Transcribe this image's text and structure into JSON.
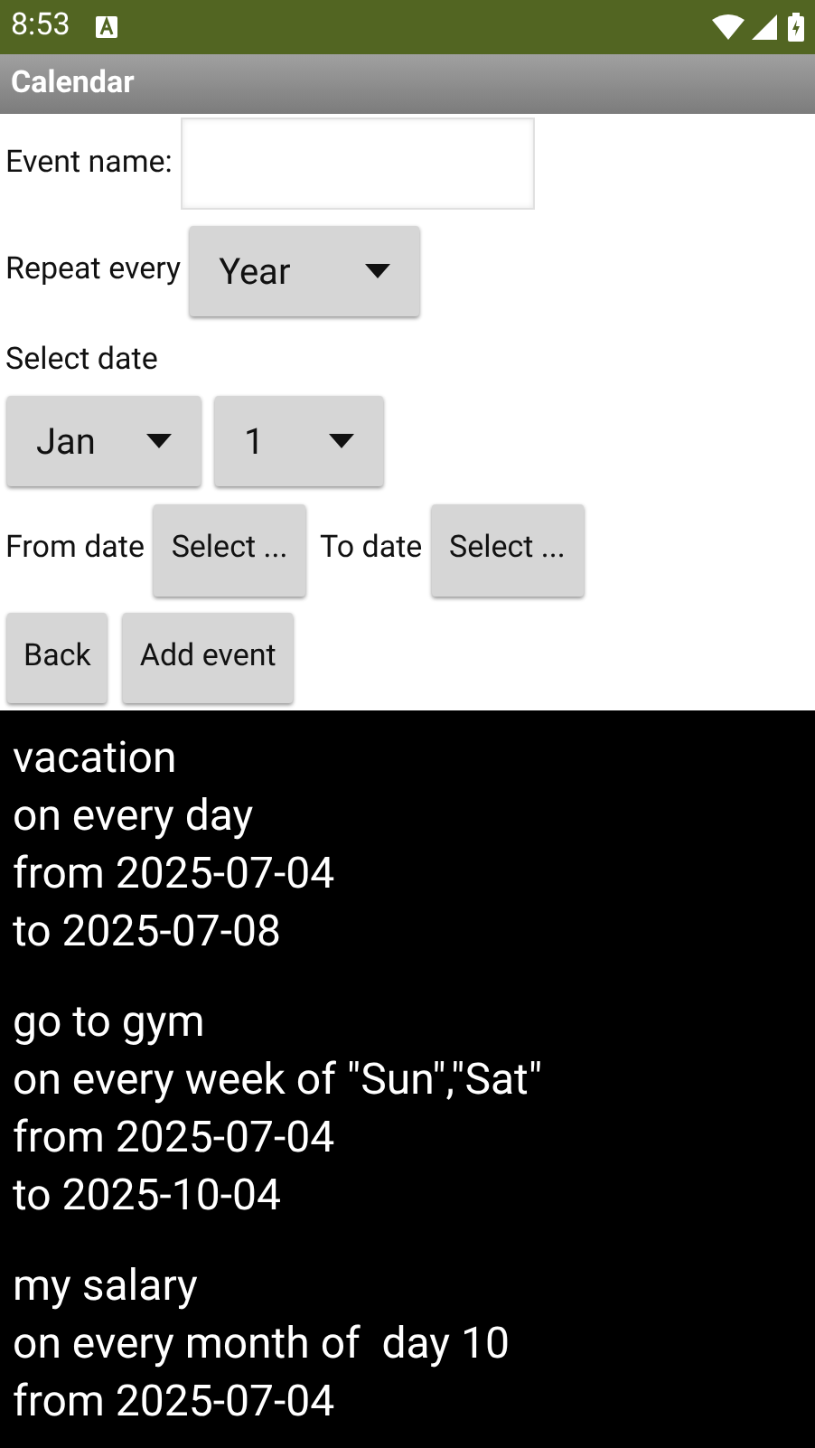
{
  "status_bar": {
    "time": "8:53"
  },
  "app_bar": {
    "title": "Calendar"
  },
  "form": {
    "event_name": {
      "label": "Event name:"
    },
    "repeat": {
      "label": "Repeat every",
      "value": "Year"
    },
    "select_date": {
      "label": "Select date",
      "month": "Jan",
      "day": "1"
    },
    "from_date": {
      "label": "From date",
      "button": "Select ..."
    },
    "to_date": {
      "label": "To date",
      "button": "Select ..."
    },
    "buttons": [
      "Back",
      "Add event"
    ]
  },
  "events": [
    {
      "lines": [
        "vacation",
        "on every day",
        "from 2025-07-04",
        "to 2025-07-08"
      ]
    },
    {
      "lines": [
        "go to gym",
        "on every week of \"Sun\",\"Sat\"",
        "from 2025-07-04",
        "to 2025-10-04"
      ]
    },
    {
      "lines": [
        "my salary",
        "on every month of  day 10",
        "from 2025-07-04"
      ]
    }
  ]
}
